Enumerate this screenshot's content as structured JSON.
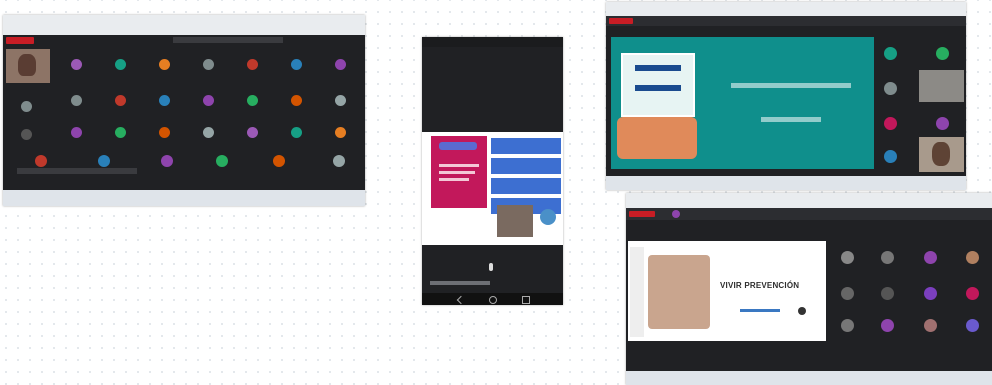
{
  "screenshot_a": {
    "brand_label": "",
    "status_text": ""
  },
  "phone": {
    "card_lines": [
      "",
      "",
      ""
    ]
  },
  "screenshot_c": {
    "slide_title": "",
    "slide_subtitle": ""
  },
  "screenshot_d": {
    "slide_title": "VIVIR PREVENCIÓN"
  },
  "colors": {
    "meet_dark": "#202124",
    "teal_slide": "#0f8f8c",
    "brand_red": "#c81d25",
    "phone_magenta": "#c2185b",
    "phone_blue": "#3d6fd1"
  },
  "icons": [
    "avatar-icon",
    "mic-icon",
    "camera-icon",
    "hangup-icon",
    "taskbar-icon"
  ]
}
